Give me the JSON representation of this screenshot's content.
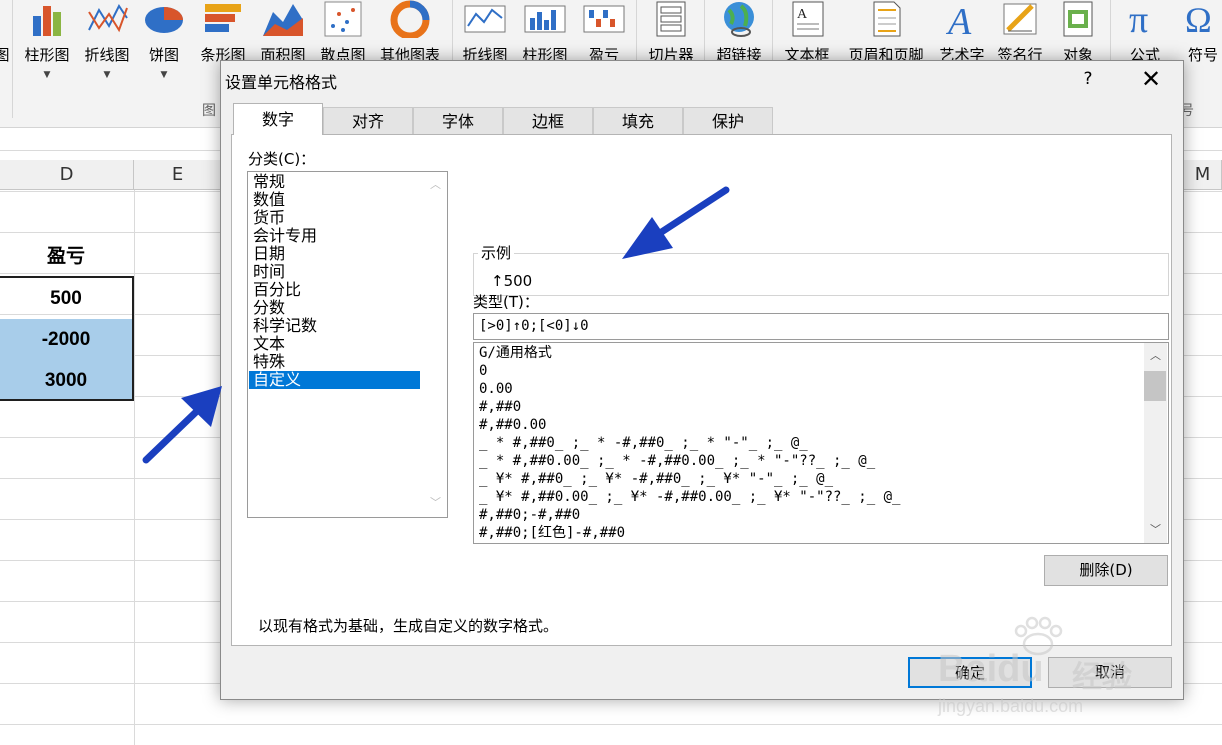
{
  "ribbon": {
    "items": [
      {
        "label": "图",
        "icon": "chart-icon"
      },
      {
        "label": "柱形图",
        "icon": "column-chart-icon"
      },
      {
        "label": "折线图",
        "icon": "line-chart-icon"
      },
      {
        "label": "饼图",
        "icon": "pie-chart-icon"
      },
      {
        "label": "条形图",
        "icon": "bar-chart-icon"
      },
      {
        "label": "面积图",
        "icon": "area-chart-icon"
      },
      {
        "label": "散点图",
        "icon": "scatter-chart-icon"
      },
      {
        "label": "其他图表",
        "icon": "other-chart-icon"
      },
      {
        "label": "折线图",
        "icon": "sparkline-line-icon"
      },
      {
        "label": "柱形图",
        "icon": "sparkline-column-icon"
      },
      {
        "label": "盈亏",
        "icon": "sparkline-winloss-icon"
      },
      {
        "label": "切片器",
        "icon": "slicer-icon"
      },
      {
        "label": "超链接",
        "icon": "hyperlink-icon"
      },
      {
        "label": "文本框",
        "icon": "textbox-icon"
      },
      {
        "label": "页眉和页脚",
        "icon": "header-footer-icon"
      },
      {
        "label": "艺术字",
        "icon": "wordart-icon"
      },
      {
        "label": "签名行",
        "icon": "signature-line-icon"
      },
      {
        "label": "对象",
        "icon": "object-icon"
      },
      {
        "label": "公式",
        "icon": "equation-icon"
      },
      {
        "label": "符号",
        "icon": "symbol-icon"
      }
    ],
    "group_chart": "图",
    "group_symbol": "号"
  },
  "sheet": {
    "columns": [
      "D",
      "E",
      "M"
    ],
    "cells": {
      "header": "盈亏",
      "values": [
        "500",
        "-2000",
        "3000"
      ]
    },
    "accent": "#a8cdea"
  },
  "dialog": {
    "title": "设置单元格格式",
    "help": "?",
    "close": "✕",
    "tabs": [
      "数字",
      "对齐",
      "字体",
      "边框",
      "填充",
      "保护"
    ],
    "category_label": "分类(C)：",
    "categories": [
      "常规",
      "数值",
      "货币",
      "会计专用",
      "日期",
      "时间",
      "百分比",
      "分数",
      "科学记数",
      "文本",
      "特殊",
      "自定义"
    ],
    "selected_category": "自定义",
    "sample_label": "示例",
    "sample_value": "↑500",
    "type_label": "类型(T)：",
    "type_value": "[>0]↑0;[<0]↓0",
    "formats": [
      "G/通用格式",
      "0",
      "0.00",
      "#,##0",
      "#,##0.00",
      "_ * #,##0_ ;_ * -#,##0_ ;_ * \"-\"_ ;_ @_",
      "_ * #,##0.00_ ;_ * -#,##0.00_ ;_ * \"-\"??_ ;_ @_",
      "_ ¥* #,##0_ ;_ ¥* -#,##0_ ;_ ¥* \"-\"_ ;_ @_",
      "_ ¥* #,##0.00_ ;_ ¥* -#,##0.00_ ;_ ¥* \"-\"??_ ;_ @_",
      "#,##0;-#,##0",
      "#,##0;[红色]-#,##0"
    ],
    "delete_button": "删除(D)",
    "description": "以现有格式为基础，生成自定义的数字格式。",
    "ok_button": "确定",
    "cancel_button": "取消",
    "accent": "#0078d7"
  },
  "annotation": {
    "arrow_color": "#1a3fbf"
  },
  "watermark": {
    "brand": "Baidu",
    "cn": "经验",
    "url": "jingyan.baidu.com"
  }
}
